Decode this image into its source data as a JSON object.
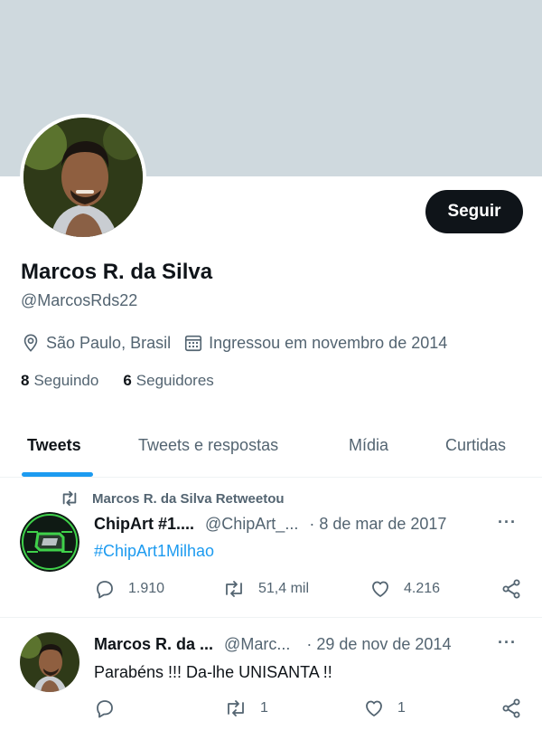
{
  "profile": {
    "name": "Marcos R. da Silva",
    "handle": "@MarcosRds22",
    "location": "São Paulo, Brasil",
    "joined": "Ingressou em novembro de 2014",
    "following_count": "8",
    "following_label": "Seguindo",
    "followers_count": "6",
    "followers_label": "Seguidores",
    "follow_button": "Seguir",
    "banner_color": "#cfd9de"
  },
  "tabs": [
    {
      "label": "Tweets",
      "active": true
    },
    {
      "label": "Tweets e respostas",
      "active": false
    },
    {
      "label": "Mídia",
      "active": false
    },
    {
      "label": "Curtidas",
      "active": false
    }
  ],
  "tweets": [
    {
      "retweet_note": "Marcos R. da Silva Retweetou",
      "name": "ChipArt #1....",
      "handle": "@ChipArt_...",
      "date": "· 8 de mar de 2017",
      "text": "#ChipArt1Milhao",
      "replies": "1.910",
      "retweets": "51,4 mil",
      "likes": "4.216",
      "more": "···"
    },
    {
      "name": "Marcos R. da ...",
      "handle": "@Marc...",
      "date": "· 29 de nov de 2014",
      "text": "Parabéns !!! Da-lhe UNISANTA !!",
      "replies": "",
      "retweets": "1",
      "likes": "1",
      "more": "···"
    }
  ],
  "colors": {
    "accent": "#1d9bf0",
    "text_primary": "#0f1419",
    "text_secondary": "#536471",
    "button_bg": "#0f1419"
  },
  "icons": [
    "location-icon",
    "calendar-icon",
    "retweet-icon",
    "reply-icon",
    "like-icon",
    "share-icon",
    "more-icon"
  ]
}
